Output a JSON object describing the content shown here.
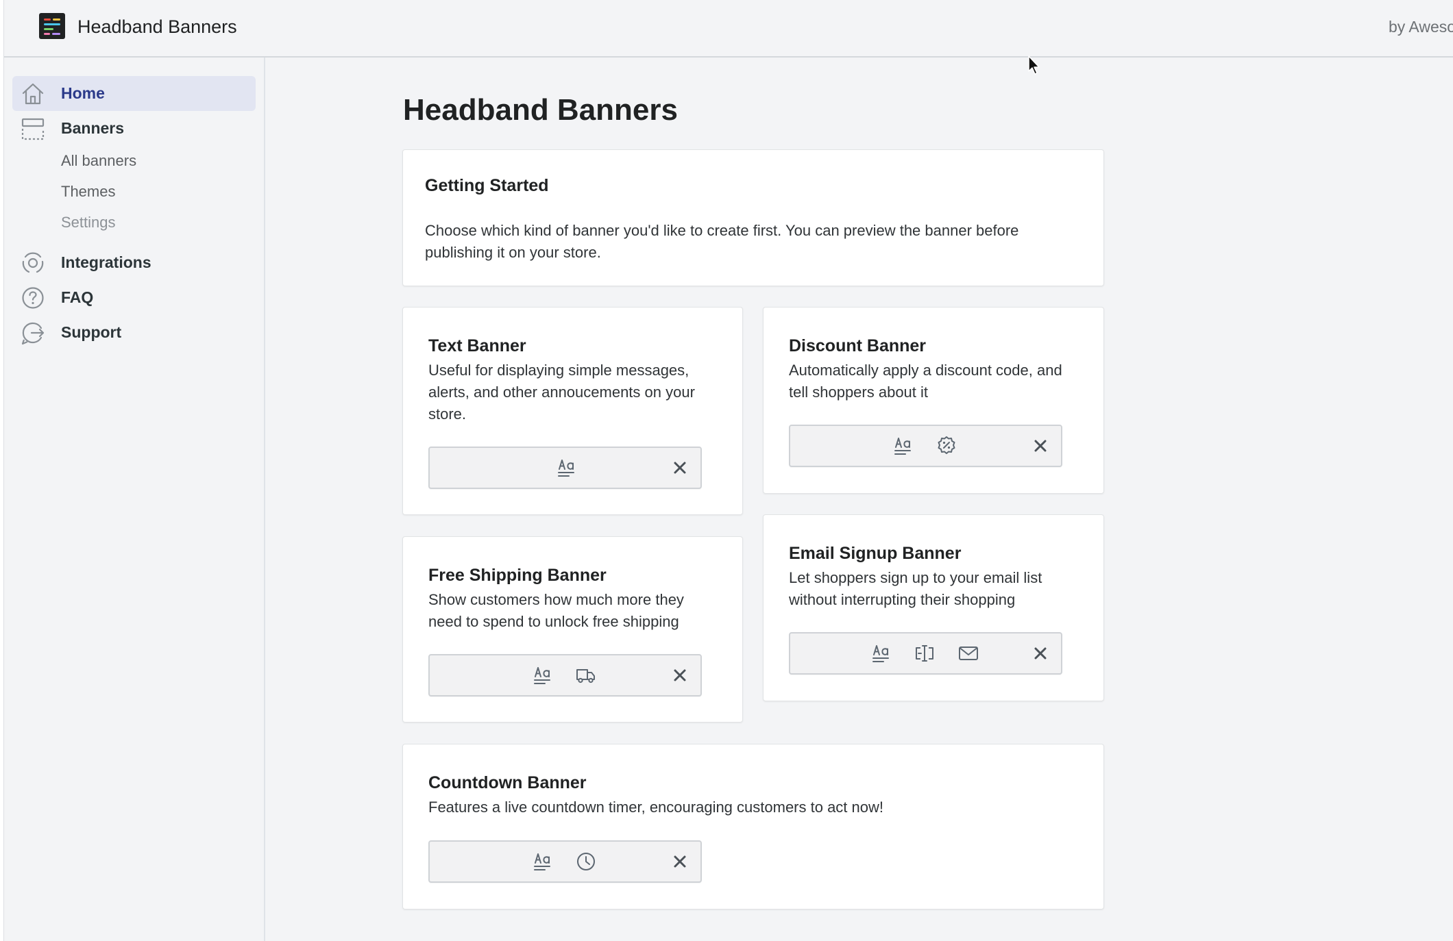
{
  "app": {
    "title": "Headband Banners",
    "byline": "by Aweso",
    "logo_icon": "colorful-lines-logo"
  },
  "sidebar": {
    "items": [
      {
        "label": "Home",
        "icon": "home-icon",
        "active": true
      },
      {
        "label": "Banners",
        "icon": "banner-layout-icon"
      },
      {
        "label": "Integrations",
        "icon": "integrations-icon"
      },
      {
        "label": "FAQ",
        "icon": "question-circle-icon"
      },
      {
        "label": "Support",
        "icon": "chat-support-icon"
      }
    ],
    "banners_sub": [
      {
        "label": "All banners"
      },
      {
        "label": "Themes"
      },
      {
        "label": "Settings"
      }
    ]
  },
  "main": {
    "page_title": "Headband Banners",
    "getting_started": {
      "title": "Getting Started",
      "line1": "Choose which kind of banner you'd like to create first. You can preview the banner before",
      "line2": "publishing it on your store."
    },
    "cards": {
      "text": {
        "title": "Text Banner",
        "desc": [
          "Useful for displaying simple messages,",
          "alerts, and other annoucements on your",
          "store."
        ],
        "preview_icons": [
          "text-format-icon",
          "close-icon"
        ]
      },
      "discount": {
        "title": "Discount Banner",
        "desc": [
          "Automatically apply a discount code, and",
          "tell shoppers about it"
        ],
        "preview_icons": [
          "text-format-icon",
          "discount-badge-icon",
          "close-icon"
        ]
      },
      "shipping": {
        "title": "Free Shipping Banner",
        "desc": [
          "Show customers how much more they",
          "need to spend to unlock free shipping"
        ],
        "preview_icons": [
          "text-format-icon",
          "truck-icon",
          "close-icon"
        ]
      },
      "email": {
        "title": "Email Signup Banner",
        "desc": [
          "Let shoppers sign up to your email list",
          "without interrupting their shopping"
        ],
        "preview_icons": [
          "text-format-icon",
          "text-cursor-field-icon",
          "envelope-icon",
          "close-icon"
        ]
      },
      "countdown": {
        "title": "Countdown Banner",
        "desc": [
          "Features a live countdown timer, encouraging customers to act now!"
        ],
        "preview_icons": [
          "text-format-icon",
          "clock-icon",
          "close-icon"
        ]
      }
    }
  },
  "colors": {
    "background": "#f3f4f6",
    "active_nav_bg": "#e2e5f2",
    "active_nav_text": "#2b3a8a",
    "card_bg": "#ffffff",
    "icon": "#5c6670"
  }
}
